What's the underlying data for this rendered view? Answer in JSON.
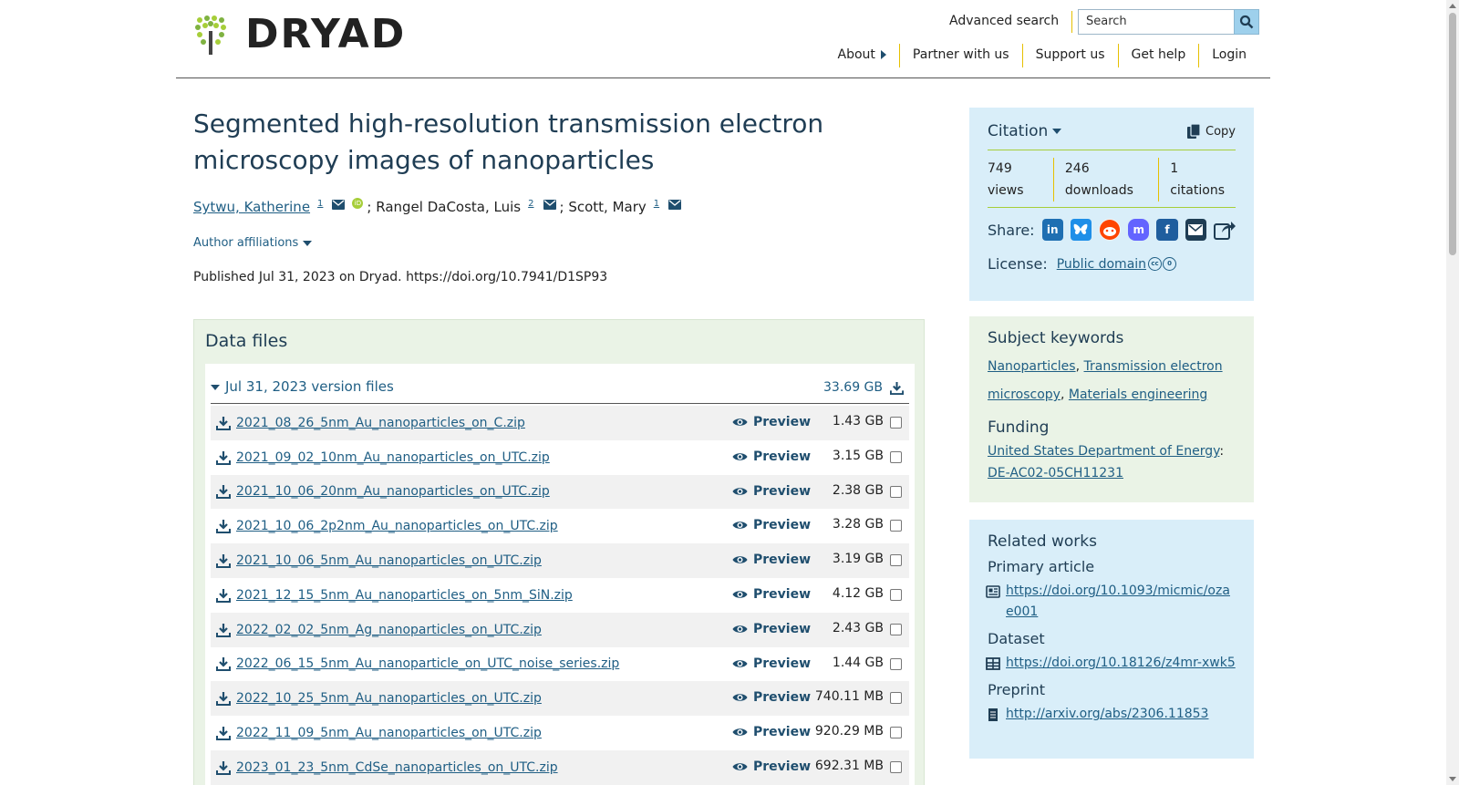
{
  "brand": {
    "name": "DRYAD"
  },
  "header": {
    "advanced_search": "Advanced search",
    "search_placeholder": "Search",
    "nav": [
      "About",
      "Partner with us",
      "Support us",
      "Get help",
      "Login"
    ]
  },
  "dataset": {
    "title": "Segmented high-resolution transmission electron microscopy images of nanoparticles",
    "authors": [
      {
        "name": "Sytwu, Katherine",
        "affil": "1",
        "linked": true
      },
      {
        "name": "; Rangel DaCosta, Luis",
        "affil": "2",
        "linked": false
      },
      {
        "name": "; Scott, Mary",
        "affil": "1",
        "linked": false
      }
    ],
    "affiliations_toggle": "Author affiliations",
    "published": "Published Jul 31, 2023 on Dryad. https://doi.org/10.7941/D1SP93"
  },
  "data_files": {
    "heading": "Data files",
    "version_label": "Jul 31, 2023 version files",
    "version_size": "33.69 GB",
    "preview_label": "Preview",
    "files": [
      {
        "name": "2021_08_26_5nm_Au_nanoparticles_on_C.zip",
        "size": "1.43 GB"
      },
      {
        "name": "2021_09_02_10nm_Au_nanoparticles_on_UTC.zip",
        "size": "3.15 GB"
      },
      {
        "name": "2021_10_06_20nm_Au_nanoparticles_on_UTC.zip",
        "size": "2.38 GB"
      },
      {
        "name": "2021_10_06_2p2nm_Au_nanoparticles_on_UTC.zip",
        "size": "3.28 GB"
      },
      {
        "name": "2021_10_06_5nm_Au_nanoparticles_on_UTC.zip",
        "size": "3.19 GB"
      },
      {
        "name": "2021_12_15_5nm_Au_nanoparticles_on_5nm_SiN.zip",
        "size": "4.12 GB"
      },
      {
        "name": "2022_02_02_5nm_Ag_nanoparticles_on_UTC.zip",
        "size": "2.43 GB"
      },
      {
        "name": "2022_06_15_5nm_Au_nanoparticle_on_UTC_noise_series.zip",
        "size": "1.44 GB"
      },
      {
        "name": "2022_10_25_5nm_Au_nanoparticles_on_UTC.zip",
        "size": "740.11 MB"
      },
      {
        "name": "2022_11_09_5nm_Au_nanoparticles_on_UTC.zip",
        "size": "920.29 MB"
      },
      {
        "name": "2023_01_23_5nm_CdSe_nanoparticles_on_UTC.zip",
        "size": "692.31 MB"
      }
    ]
  },
  "citation": {
    "heading": "Citation",
    "copy_label": "Copy",
    "stats": [
      {
        "value": "749",
        "label": "views"
      },
      {
        "value": "246",
        "label": "downloads"
      },
      {
        "value": "1",
        "label": "citations"
      }
    ],
    "share_label": "Share:",
    "share_icons": [
      "linkedin-icon",
      "bluesky-icon",
      "reddit-icon",
      "mastodon-icon",
      "facebook-icon",
      "email-icon",
      "share-icon"
    ],
    "license_label": "License:",
    "license_value": "Public domain"
  },
  "keywords": {
    "heading": "Subject keywords",
    "items": [
      "Nanoparticles",
      "Transmission electron microscopy",
      "Materials engineering"
    ],
    "funding_heading": "Funding",
    "funder": "United States Department of Energy",
    "award": "DE-AC02-05CH11231"
  },
  "related": {
    "heading": "Related works",
    "groups": [
      {
        "label": "Primary article",
        "url": "https://doi.org/10.1093/micmic/ozae001",
        "icon": "article-icon"
      },
      {
        "label": "Dataset",
        "url": "https://doi.org/10.18126/z4mr-xwk5",
        "icon": "table-icon"
      },
      {
        "label": "Preprint",
        "url": "http://arxiv.org/abs/2306.11853",
        "icon": "document-icon"
      }
    ]
  },
  "colors": {
    "brand_green": "#a6ce39",
    "link_blue": "#1f5e84",
    "panel_blue": "#d9eef9",
    "panel_green": "#eaf3e6",
    "divider_yellow": "#e6c000"
  }
}
